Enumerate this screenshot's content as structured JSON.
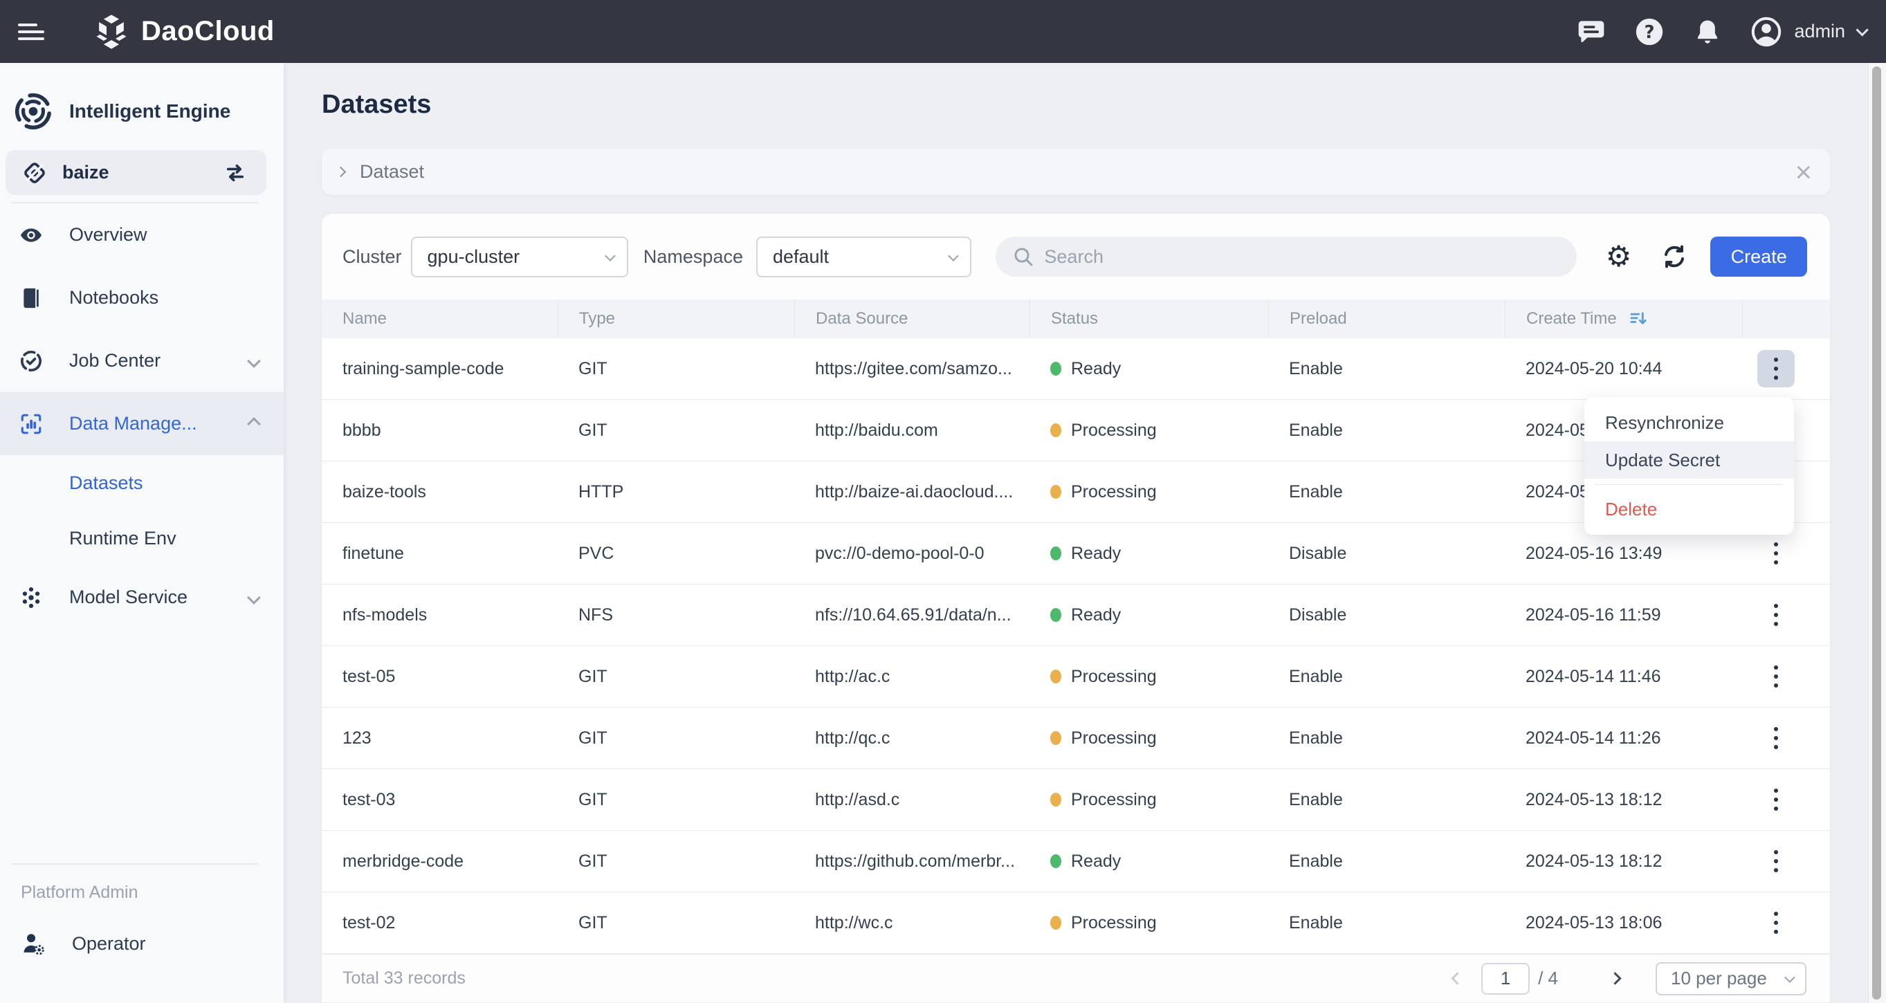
{
  "topbar": {
    "brand": "DaoCloud",
    "user": "admin"
  },
  "sidebar": {
    "product": "Intelligent Engine",
    "workspace": "baize",
    "items": [
      {
        "label": "Overview"
      },
      {
        "label": "Notebooks"
      },
      {
        "label": "Job Center"
      },
      {
        "label": "Data Manage..."
      },
      {
        "label": "Model Service"
      }
    ],
    "sub_items": [
      {
        "label": "Datasets"
      },
      {
        "label": "Runtime Env"
      }
    ],
    "section_label": "Platform Admin",
    "admin_item": "Operator"
  },
  "page": {
    "title": "Datasets"
  },
  "panel": {
    "label": "Dataset"
  },
  "filters": {
    "cluster_label": "Cluster",
    "cluster_value": "gpu-cluster",
    "namespace_label": "Namespace",
    "namespace_value": "default",
    "search_placeholder": "Search",
    "create_label": "Create"
  },
  "table": {
    "columns": [
      "Name",
      "Type",
      "Data Source",
      "Status",
      "Preload",
      "Create Time"
    ],
    "rows": [
      {
        "name": "training-sample-code",
        "type": "GIT",
        "source": "https://gitee.com/samzo...",
        "status": "Ready",
        "status_color": "green",
        "preload": "Enable",
        "time": "2024-05-20 10:44",
        "actions_active": true
      },
      {
        "name": "bbbb",
        "type": "GIT",
        "source": "http://baidu.com",
        "status": "Processing",
        "status_color": "orange",
        "preload": "Enable",
        "time": "2024-05"
      },
      {
        "name": "baize-tools",
        "type": "HTTP",
        "source": "http://baize-ai.daocloud....",
        "status": "Processing",
        "status_color": "orange",
        "preload": "Enable",
        "time": "2024-05"
      },
      {
        "name": "finetune",
        "type": "PVC",
        "source": "pvc://0-demo-pool-0-0",
        "status": "Ready",
        "status_color": "green",
        "preload": "Disable",
        "time": "2024-05-16 13:49"
      },
      {
        "name": "nfs-models",
        "type": "NFS",
        "source": "nfs://10.64.65.91/data/n...",
        "status": "Ready",
        "status_color": "green",
        "preload": "Disable",
        "time": "2024-05-16 11:59"
      },
      {
        "name": "test-05",
        "type": "GIT",
        "source": "http://ac.c",
        "status": "Processing",
        "status_color": "orange",
        "preload": "Enable",
        "time": "2024-05-14 11:46"
      },
      {
        "name": "123",
        "type": "GIT",
        "source": "http://qc.c",
        "status": "Processing",
        "status_color": "orange",
        "preload": "Enable",
        "time": "2024-05-14 11:26"
      },
      {
        "name": "test-03",
        "type": "GIT",
        "source": "http://asd.c",
        "status": "Processing",
        "status_color": "orange",
        "preload": "Enable",
        "time": "2024-05-13 18:12"
      },
      {
        "name": "merbridge-code",
        "type": "GIT",
        "source": "https://github.com/merbr...",
        "status": "Ready",
        "status_color": "green",
        "preload": "Enable",
        "time": "2024-05-13 18:12"
      },
      {
        "name": "test-02",
        "type": "GIT",
        "source": "http://wc.c",
        "status": "Processing",
        "status_color": "orange",
        "preload": "Enable",
        "time": "2024-05-13 18:06"
      }
    ]
  },
  "context_menu": {
    "items": [
      {
        "label": "Resynchronize"
      },
      {
        "label": "Update Secret",
        "highlight": true
      },
      {
        "label": "Delete",
        "danger": true,
        "divider_before": true
      }
    ]
  },
  "footer": {
    "total": "Total 33 records",
    "page_value": "1",
    "page_total": "/ 4",
    "per_page": "10 per page"
  },
  "colors": {
    "accent_blue": "#3b6be5",
    "link_blue": "#3366d9",
    "status_ready": "#4db96a",
    "status_processing": "#e9b04b",
    "danger_red": "#e4584c",
    "topbar_bg": "#343741"
  }
}
